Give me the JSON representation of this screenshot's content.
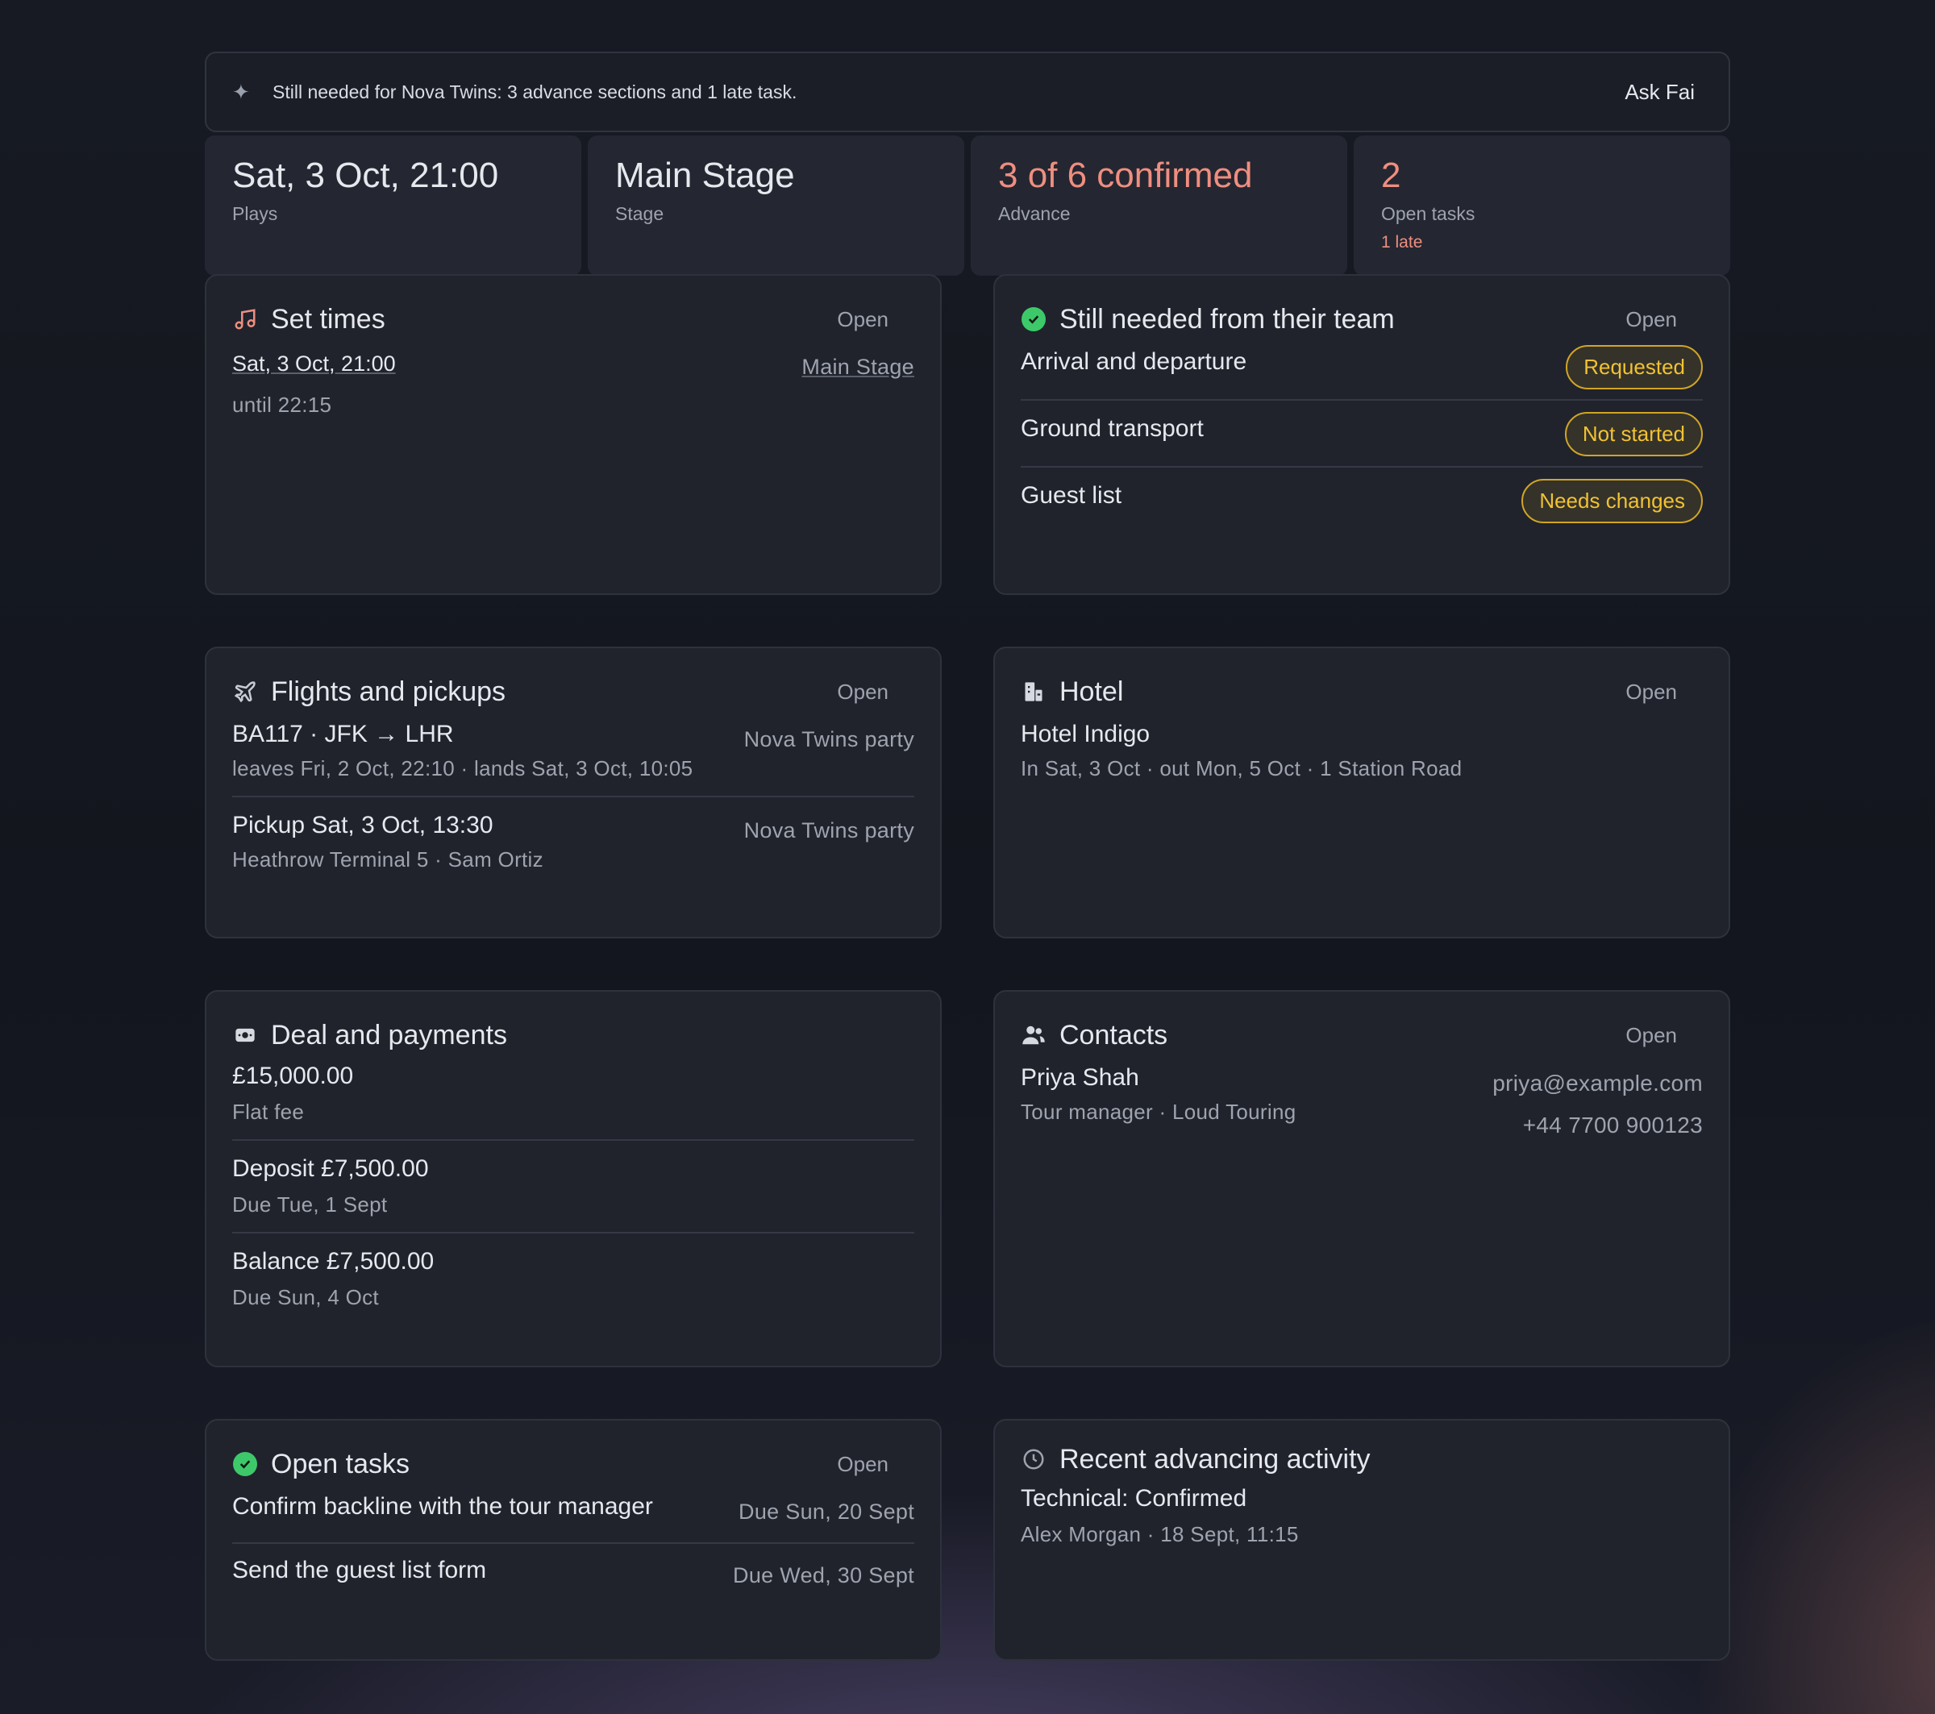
{
  "banner": {
    "message": "Still needed for Nova Twins: 3 advance sections and 1 late task.",
    "ask_label": "Ask Fai"
  },
  "stats": [
    {
      "value": "Sat, 3 Oct, 21:00",
      "label": "Plays"
    },
    {
      "value": "Main Stage",
      "label": "Stage"
    },
    {
      "value": "3 of 6 confirmed",
      "label": "Advance"
    },
    {
      "value": "2",
      "label": "Open tasks",
      "note": "1 late"
    }
  ],
  "set_times": {
    "title": "Set times",
    "open_label": "Open",
    "start": "Sat, 3 Oct, 21:00",
    "until": "until 22:15",
    "stage": "Main Stage"
  },
  "still_needed": {
    "title": "Still needed from their team",
    "open_label": "Open",
    "items": [
      {
        "label": "Arrival and departure",
        "status": "Requested"
      },
      {
        "label": "Ground transport",
        "status": "Not started"
      },
      {
        "label": "Guest list",
        "status": "Needs changes"
      }
    ]
  },
  "flights": {
    "title": "Flights and pickups",
    "open_label": "Open",
    "items": [
      {
        "main": "BA117 · JFK → LHR",
        "sub": "leaves Fri, 2 Oct, 22:10 · lands Sat, 3 Oct, 10:05",
        "side": "Nova Twins party"
      },
      {
        "main": "Pickup Sat, 3 Oct, 13:30",
        "sub": "Heathrow Terminal 5 · Sam Ortiz",
        "side": "Nova Twins party"
      }
    ]
  },
  "hotel": {
    "title": "Hotel",
    "open_label": "Open",
    "name": "Hotel Indigo",
    "details": "In Sat, 3 Oct · out Mon, 5 Oct · 1 Station Road"
  },
  "deal": {
    "title": "Deal and payments",
    "items": [
      {
        "main": "£15,000.00",
        "sub": "Flat fee"
      },
      {
        "main": "Deposit £7,500.00",
        "sub": "Due Tue, 1 Sept"
      },
      {
        "main": "Balance £7,500.00",
        "sub": "Due Sun, 4 Oct"
      }
    ]
  },
  "contacts": {
    "title": "Contacts",
    "open_label": "Open",
    "name": "Priya Shah",
    "role": "Tour manager · Loud Touring",
    "email": "priya@example.com",
    "phone": "+44 7700 900123"
  },
  "tasks": {
    "title": "Open tasks",
    "open_label": "Open",
    "items": [
      {
        "label": "Confirm backline with the tour manager",
        "due": "Due Sun, 20 Sept"
      },
      {
        "label": "Send the guest list form",
        "due": "Due Wed, 30 Sept"
      }
    ]
  },
  "activity": {
    "title": "Recent advancing activity",
    "items": [
      {
        "main": "Technical: Confirmed",
        "sub": "Alex Morgan · 18 Sept, 11:15"
      }
    ]
  },
  "colors": {
    "accent_warn": "#ef8e80",
    "status_pill": "#f1c232",
    "confirmed_green": "#3dc96a"
  }
}
